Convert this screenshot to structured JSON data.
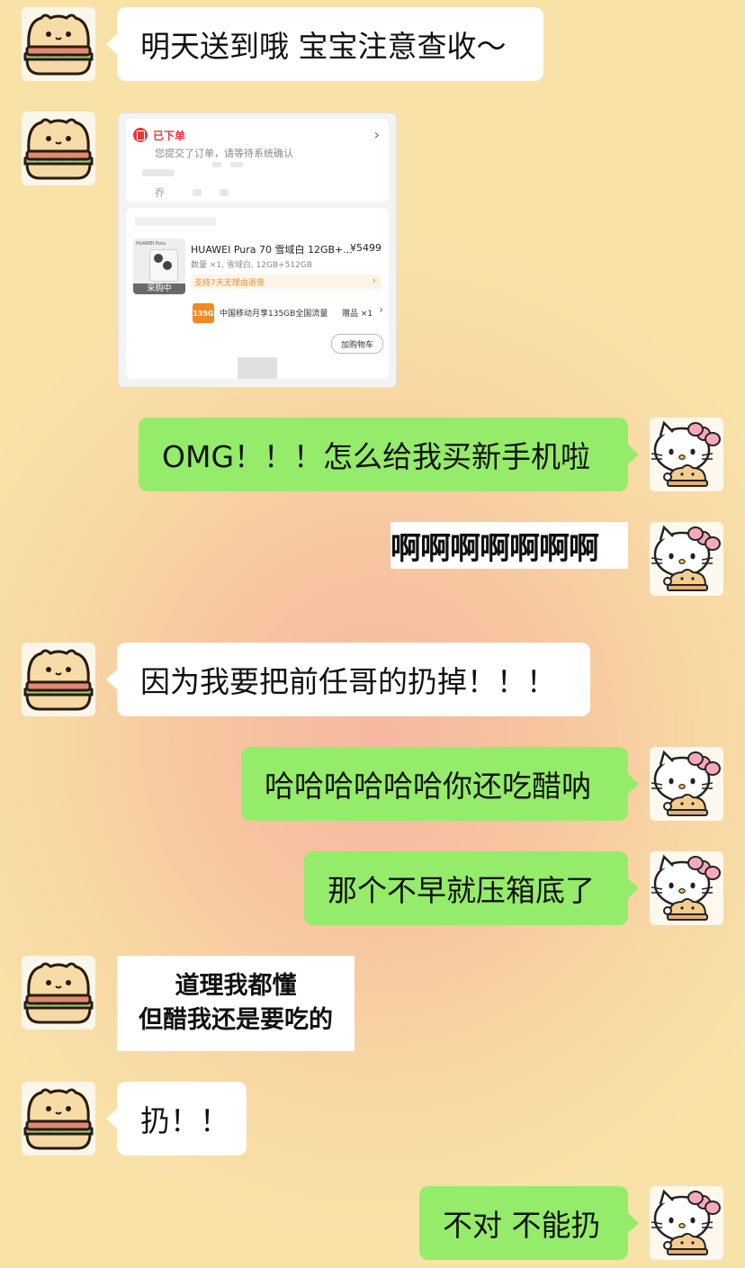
{
  "messages": {
    "m1": "明天送到哦 宝宝注意查收～",
    "m2": "OMG！！！怎么给我买新手机啦",
    "m3": "啊啊啊啊啊啊啊",
    "m4": "因为我要把前任哥的扔掉！！！",
    "m5": "哈哈哈哈哈哈你还吃醋呐",
    "m6": "那个不早就压箱底了",
    "m7_line1": "道理我都懂",
    "m7_line2": "但醋我还是要吃的",
    "m8": "扔！！",
    "m9": "不对 不能扔"
  },
  "order_card": {
    "status": "已下单",
    "status_desc": "您提交了订单，请等待系统确认",
    "chevron": "›",
    "name_char": "乔",
    "product_title": "HUAWEI Pura 70 雪域白 12GB+...",
    "price": "¥5499",
    "product_spec": "数量 ×1, 雪域白, 12GB+512GB",
    "purchasing_badge": "采购中",
    "return_policy": "支持7天无理由退货",
    "gift_thumb": "135G",
    "gift_name": "中国移动月享135GB全国流量",
    "gift_label": "赠品 ×1",
    "add_cart": "加购物车",
    "thumb_brand": "HUAWEI Pura"
  },
  "colors": {
    "bubble_out": "#95ec6a",
    "bubble_in": "#ffffff",
    "status_red": "#e4393c",
    "accent_orange": "#f08a24"
  },
  "icons": {
    "sender_avatar": "sandwich-bear-avatar",
    "self_avatar": "hello-kitty-avatar",
    "order_status_icon": "order-doc-icon"
  }
}
